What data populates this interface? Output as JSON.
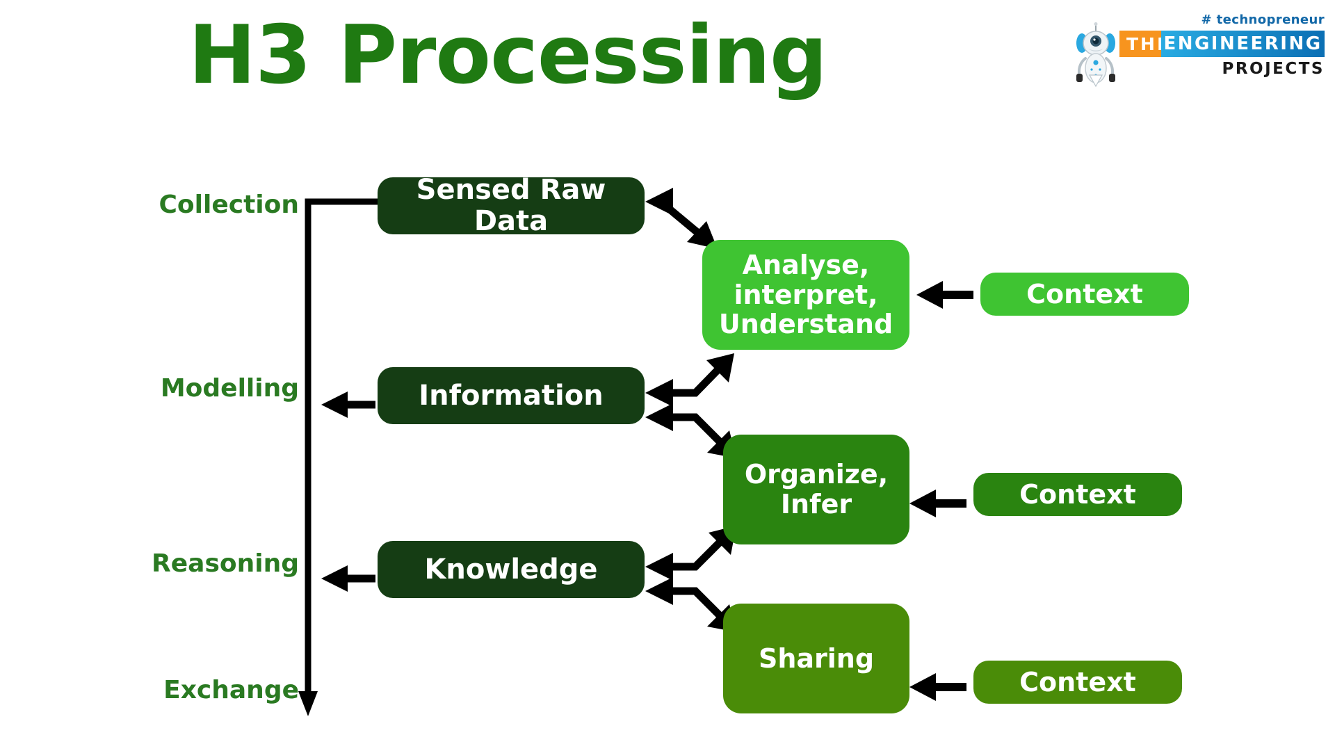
{
  "page": {
    "title": "H3 Processing",
    "title_color": "#1f7a12",
    "background": "#ffffff"
  },
  "logo": {
    "hashtag": "# technopreneur",
    "the": "THE",
    "engineering": "ENGINEERING",
    "projects": "PROJECTS",
    "robot_icon": "robot-mascot-icon",
    "orange": "#f7941e",
    "blue": "#1268a8"
  },
  "stages": [
    {
      "label": "Collection"
    },
    {
      "label": "Modelling"
    },
    {
      "label": "Reasoning"
    },
    {
      "label": "Exchange"
    }
  ],
  "nodes": {
    "sensed_raw_data": {
      "label": "Sensed Raw Data",
      "color": "#153d14"
    },
    "information": {
      "label": "Information",
      "color": "#153d14"
    },
    "knowledge": {
      "label": "Knowledge",
      "color": "#153d14"
    },
    "analyse": {
      "label": "Analyse,\ninterpret,\nUnderstand",
      "color": "#3fc432"
    },
    "organize": {
      "label": "Organize,\nInfer",
      "color": "#2a8410"
    },
    "sharing": {
      "label": "Sharing",
      "color": "#4a8c08"
    }
  },
  "context_nodes": [
    {
      "label": "Context",
      "color": "#3fc432"
    },
    {
      "label": "Context",
      "color": "#2a8410"
    },
    {
      "label": "Context",
      "color": "#4a8c08"
    }
  ],
  "connectors": {
    "arrow_color": "#000000",
    "spine_label": "vertical-stage-spine",
    "descriptions": [
      "spine from Collection row down to Exchange arrowhead",
      "Sensed Raw Data <-> Analyse double arrow",
      "Information <-> Analyse double arrow",
      "Information <-> Organize double arrow",
      "Knowledge <-> Organize double arrow",
      "Knowledge <-> Sharing double arrow",
      "Context -> Analyse arrow",
      "Context -> Organize arrow",
      "Context -> Sharing arrow",
      "Information -> Modelling arrow",
      "Knowledge -> Reasoning arrow"
    ]
  }
}
